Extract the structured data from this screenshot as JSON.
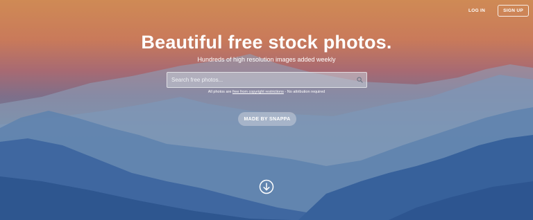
{
  "nav": {
    "login_label": "LOG IN",
    "signup_label": "SIGN UP"
  },
  "hero": {
    "headline": "Beautiful free stock photos.",
    "subheadline": "Hundreds of high resolution images added weekly"
  },
  "search": {
    "placeholder": "Search free photos...",
    "value": ""
  },
  "disclaimer": {
    "prefix": "All photos are ",
    "link_text": "free from copyright restrictions",
    "suffix": " - No attribution required"
  },
  "made_by": {
    "label": "MADE BY SNAPPA"
  },
  "icons": {
    "search": "search-icon",
    "scroll": "arrow-down-circle-icon"
  }
}
